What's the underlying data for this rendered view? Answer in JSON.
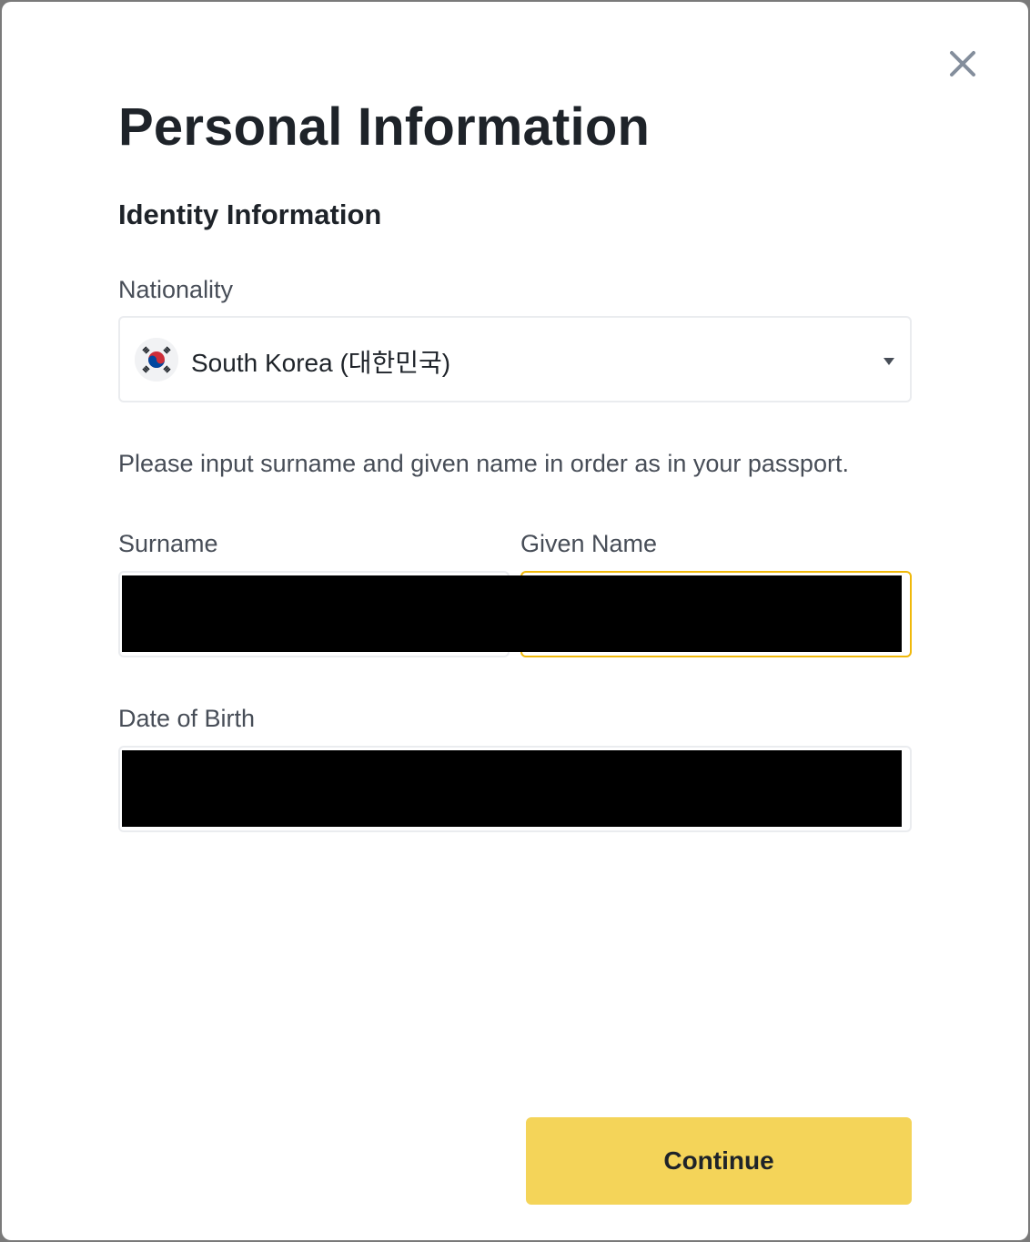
{
  "modal": {
    "title": "Personal Information",
    "section_title": "Identity Information",
    "close_icon": "close-icon"
  },
  "nationality": {
    "label": "Nationality",
    "selected_value": "South Korea (대한민국)",
    "flag_icon": "south-korea-flag-icon",
    "caret_icon": "caret-down-icon"
  },
  "hint": "Please input surname and given name in order as in your passport.",
  "fields": {
    "surname_label": "Surname",
    "given_name_label": "Given Name",
    "dob_label": "Date of Birth"
  },
  "actions": {
    "continue_label": "Continue"
  },
  "colors": {
    "accent": "#f0b90b",
    "button": "#f4d459",
    "text": "#1e2329",
    "muted": "#474d57",
    "border": "#eaecef"
  }
}
